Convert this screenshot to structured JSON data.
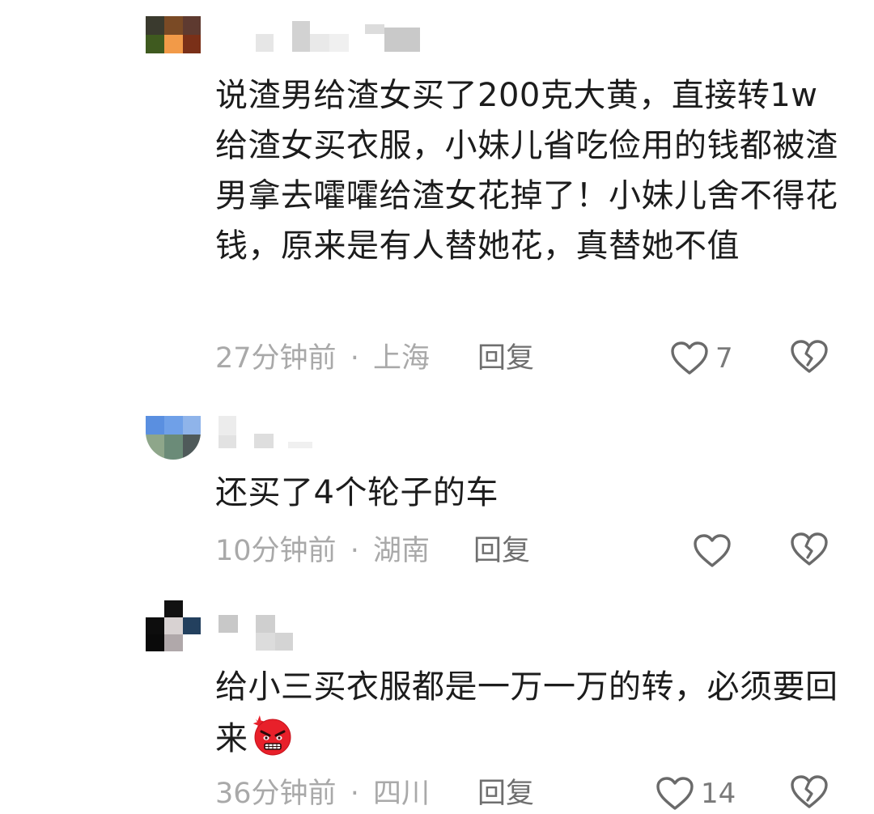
{
  "comments": [
    {
      "text": "说渣男给渣女买了200克大黄，直接转1w给渣女买衣服，小妹儿省吃俭用的钱都被渣男拿去嚯嚯给渣女花掉了！小妹儿舍不得花钱，原来是有人替她花，真替她不值",
      "time": "27分钟前",
      "location": "上海",
      "separator": "·",
      "reply_label": "回复",
      "likes": "7",
      "avatar_colors": [
        "#3a3a2e",
        "#7a4a25",
        "#5e3a30",
        "#3f5a1f",
        "#f29a48",
        "#7a3018"
      ],
      "like_icon": "heart-outline-icon",
      "dislike_icon": "broken-heart-icon"
    },
    {
      "text": "还买了4个轮子的车",
      "time": "10分钟前",
      "location": "湖南",
      "separator": "·",
      "reply_label": "回复",
      "likes": "",
      "avatar_colors": [
        "#5a8fe0",
        "#6fa0e8",
        "#8fb4ea",
        "#8ea68a",
        "#6b8b78",
        "#4f5a5a"
      ],
      "like_icon": "heart-outline-icon",
      "dislike_icon": "broken-heart-icon"
    },
    {
      "text": "给小三买衣服都是一万一万的转，必须要回来",
      "emoji": "angry-face-emoji",
      "time": "36分钟前",
      "location": "四川",
      "separator": "·",
      "reply_label": "回复",
      "likes": "14",
      "avatar_colors": [
        "#ffffff",
        "#111111",
        "#ffffff",
        "#0d0d0d",
        "#d8d2d2",
        "#23405e",
        "#0a0a0a",
        "#b0a8aa",
        "#ffffff"
      ],
      "like_icon": "heart-outline-icon",
      "dislike_icon": "broken-heart-icon"
    }
  ],
  "colors": {
    "meta": "#a9a9a9",
    "reply": "#6f6f6f",
    "text": "#1c1c1c",
    "icon_stroke": "#6a6a6a"
  }
}
